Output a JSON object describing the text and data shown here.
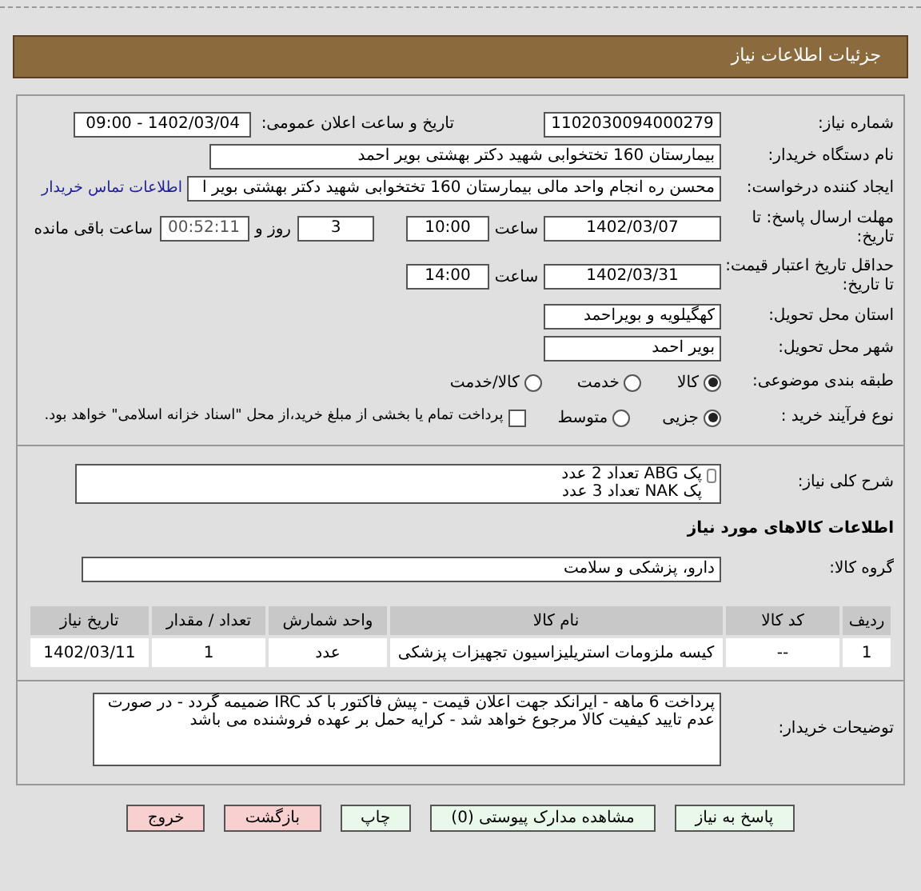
{
  "header": {
    "title": "جزئیات اطلاعات نیاز"
  },
  "need_number": {
    "label": "شماره نیاز:",
    "value": "1102030094000279"
  },
  "announce": {
    "label": "تاریخ و ساعت اعلان عمومی:",
    "value": "1402/03/04 - 09:00"
  },
  "buyer_org": {
    "label": "نام دستگاه خریدار:",
    "value": "بیمارستان 160 تختخوابی شهید دکتر بهشتی بویر احمد"
  },
  "creator": {
    "label": "ایجاد کننده درخواست:",
    "value": "محسن ره انجام واحد مالی بیمارستان 160 تختخوابی شهید دکتر بهشتی بویر ا",
    "link": "اطلاعات تماس خریدار"
  },
  "deadline": {
    "label": "مهلت ارسال پاسخ: تا تاریخ:",
    "date": "1402/03/07",
    "time_label": "ساعت",
    "time": "10:00",
    "days": "3",
    "days_label": "روز و",
    "remaining": "00:52:11",
    "remaining_label": "ساعت باقی مانده"
  },
  "validity": {
    "label": "حداقل تاریخ اعتبار قیمت: تا تاریخ:",
    "date": "1402/03/31",
    "time_label": "ساعت",
    "time": "14:00"
  },
  "province": {
    "label": "استان محل تحویل:",
    "value": "کهگیلویه و بویراحمد"
  },
  "city": {
    "label": "شهر محل تحویل:",
    "value": "بویر احمد"
  },
  "category": {
    "label": "طبقه بندی موضوعی:",
    "options": [
      {
        "label": "کالا",
        "selected": true
      },
      {
        "label": "خدمت",
        "selected": false
      },
      {
        "label": "کالا/خدمت",
        "selected": false
      }
    ]
  },
  "process": {
    "label": "نوع فرآیند خرید :",
    "options": [
      {
        "label": "جزیی",
        "selected": true
      },
      {
        "label": "متوسط",
        "selected": false
      }
    ],
    "checkbox": {
      "label": "پرداخت تمام یا بخشی از مبلغ خرید،از محل \"اسناد خزانه اسلامی\" خواهد بود.",
      "checked": false
    }
  },
  "description": {
    "label": "شرح کلی نیاز:",
    "lines": [
      "پک ABG تعداد 2 عدد",
      "پک NAK تعداد 3 عدد"
    ]
  },
  "goods_heading": "اطلاعات کالاهای مورد نیاز",
  "group": {
    "label": "گروه کالا:",
    "value": "دارو، پزشکی و سلامت"
  },
  "table": {
    "columns": [
      "ردیف",
      "کد کالا",
      "نام کالا",
      "واحد شمارش",
      "تعداد / مقدار",
      "تاریخ نیاز"
    ],
    "rows": [
      [
        "1",
        "--",
        "کیسه ملزومات استریلیزاسیون تجهیزات پزشکی",
        "عدد",
        "1",
        "1402/03/11"
      ]
    ]
  },
  "notes": {
    "label": "توضیحات خریدار:",
    "text": "پرداخت 6 ماهه - ایرانکد جهت اعلان قیمت - پیش فاکتور با کد IRC ضمیمه گردد - در صورت عدم تایید کیفیت کالا مرجوع خواهد شد - کرایه حمل بر عهده فروشنده می باشد"
  },
  "buttons": [
    {
      "label": "پاسخ به نیاز",
      "kind": "green"
    },
    {
      "label": "مشاهده مدارک پیوستی (0)",
      "kind": "green"
    },
    {
      "label": "چاپ",
      "kind": "green"
    },
    {
      "label": "بازگشت",
      "kind": "red"
    },
    {
      "label": "خروج",
      "kind": "red"
    }
  ]
}
